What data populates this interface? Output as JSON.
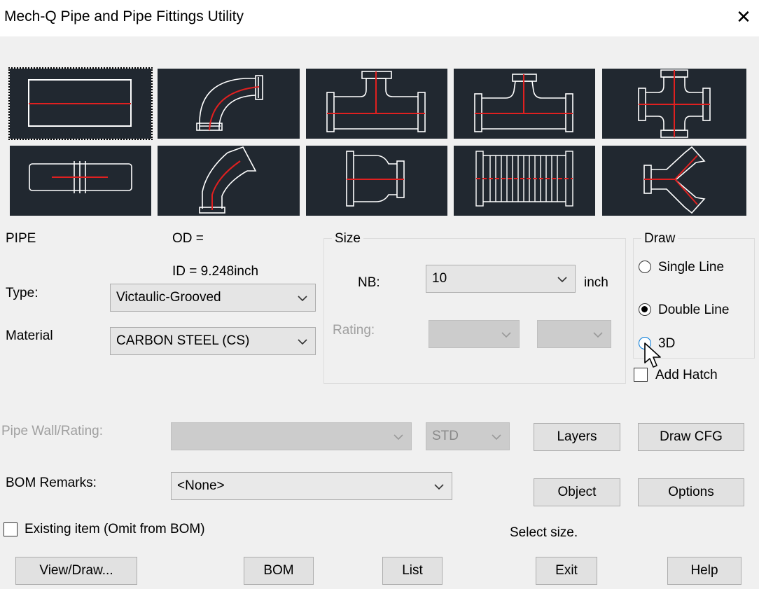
{
  "window": {
    "title": "Mech-Q Pipe and Pipe Fittings Utility"
  },
  "icons": {
    "close": "close-icon",
    "chevron": "chevron-down-icon",
    "cursor": "mouse-pointer-icon"
  },
  "colors": {
    "tile_bg": "#212830",
    "line_white": "#ffffff",
    "line_red": "#e02020"
  },
  "fittings": [
    "pipe",
    "elbow-90",
    "tee",
    "reducing-tee",
    "cross",
    "coupling",
    "elbow-45",
    "reducer",
    "flexible-hose",
    "lateral-wye"
  ],
  "pipe": {
    "label": "PIPE",
    "od": "OD =",
    "id": "ID = 9.248inch"
  },
  "type": {
    "label": "Type:",
    "value": "Victaulic-Grooved"
  },
  "material": {
    "label": "Material",
    "value": "CARBON STEEL (CS)"
  },
  "size": {
    "group": "Size",
    "nb_label": "NB:",
    "nb_value": "10",
    "unit": "inch",
    "rating_label": "Rating:",
    "rating_value1": "",
    "rating_value2": ""
  },
  "draw": {
    "group": "Draw",
    "single": "Single Line",
    "double": "Double Line",
    "threed": "3D",
    "selected": "Double Line",
    "hatch": "Add Hatch"
  },
  "wall": {
    "label": "Pipe Wall/Rating:",
    "value": "",
    "schedule": "STD"
  },
  "bom_remarks": {
    "label": "BOM Remarks:",
    "value": "<None>"
  },
  "existing": {
    "label": "Existing item (Omit from BOM)"
  },
  "status": "Select size.",
  "buttons": {
    "layers": "Layers",
    "draw_cfg": "Draw CFG",
    "object": "Object",
    "options": "Options",
    "view_draw": "View/Draw...",
    "bom": "BOM",
    "list": "List",
    "exit": "Exit",
    "help": "Help"
  }
}
